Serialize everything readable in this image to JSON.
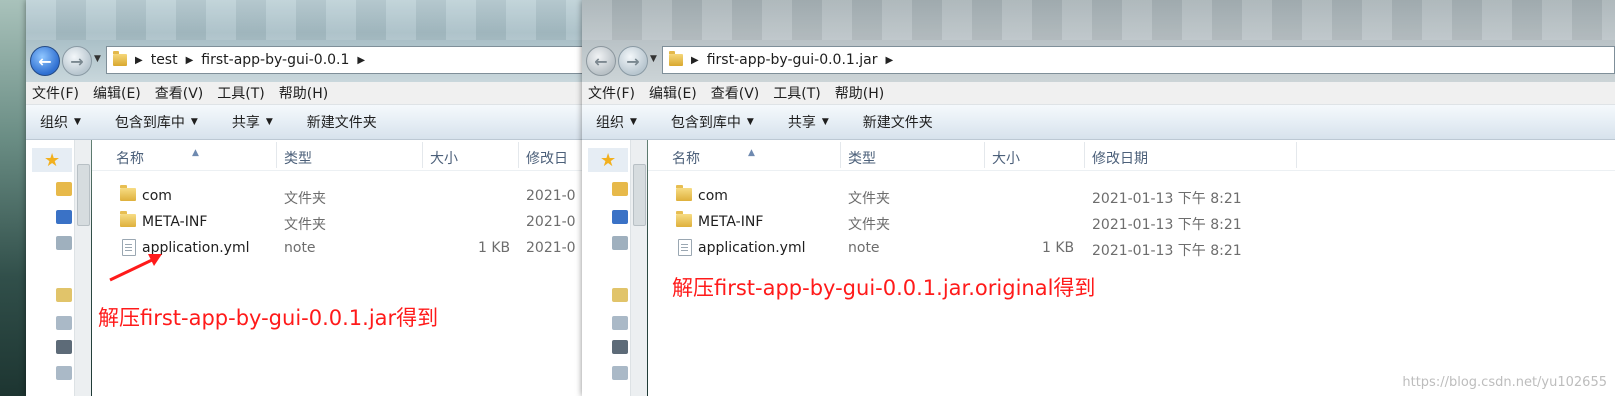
{
  "left_window": {
    "address": {
      "crumbs": [
        "test",
        "first-app-by-gui-0.0.1"
      ]
    },
    "menu": [
      "文件(F)",
      "编辑(E)",
      "查看(V)",
      "工具(T)",
      "帮助(H)"
    ],
    "commands": [
      "组织",
      "包含到库中",
      "共享",
      "新建文件夹"
    ],
    "columns": [
      "名称",
      "类型",
      "大小",
      "修改日"
    ],
    "rows": [
      {
        "name": "com",
        "type": "文件夹",
        "size": "",
        "date": "2021-0"
      },
      {
        "name": "META-INF",
        "type": "文件夹",
        "size": "",
        "date": "2021-0"
      },
      {
        "name": "application.yml",
        "type": "note",
        "size": "1 KB",
        "date": "2021-0"
      }
    ],
    "annotation": "解压first-app-by-gui-0.0.1.jar得到"
  },
  "right_window": {
    "address": {
      "crumbs": [
        "first-app-by-gui-0.0.1.jar"
      ]
    },
    "menu": [
      "文件(F)",
      "编辑(E)",
      "查看(V)",
      "工具(T)",
      "帮助(H)"
    ],
    "commands": [
      "组织",
      "包含到库中",
      "共享",
      "新建文件夹"
    ],
    "columns": [
      "名称",
      "类型",
      "大小",
      "修改日期"
    ],
    "rows": [
      {
        "name": "com",
        "type": "文件夹",
        "size": "",
        "date": "2021-01-13 下午 8:21"
      },
      {
        "name": "META-INF",
        "type": "文件夹",
        "size": "",
        "date": "2021-01-13 下午 8:21"
      },
      {
        "name": "application.yml",
        "type": "note",
        "size": "1 KB",
        "date": "2021-01-13 下午 8:21"
      }
    ],
    "annotation": "解压first-app-by-gui-0.0.1.jar.original得到"
  },
  "watermark": "https://blog.csdn.net/yu102655",
  "colors": {
    "annotation": "#ff1a1a",
    "accent": "#2f6fd1"
  }
}
